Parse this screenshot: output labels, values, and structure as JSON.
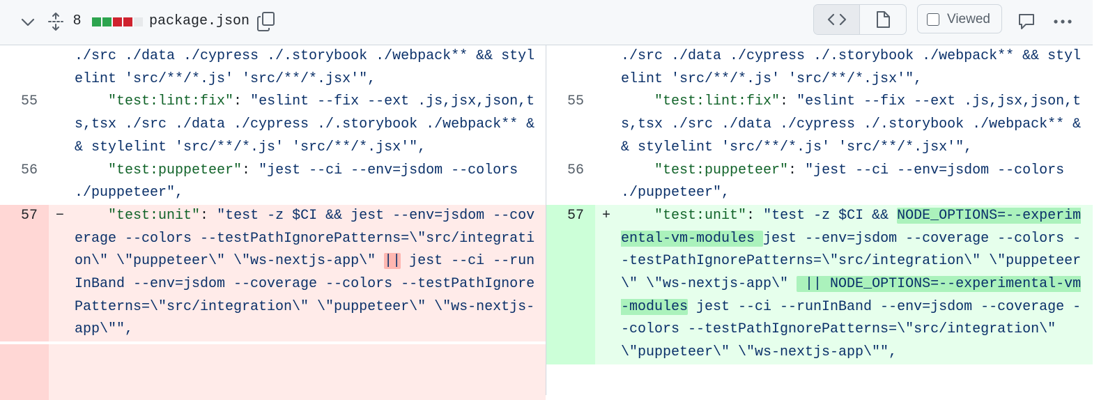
{
  "header": {
    "changes_count": "8",
    "diffstat_colors": [
      "#2da44e",
      "#2da44e",
      "#cf222e",
      "#cf222e",
      "#e7e9eb"
    ],
    "file_name": "package.json",
    "icons": {
      "collapse": "chevron-down-icon",
      "expand": "fold-expand-icon",
      "copy": "copy-icon",
      "code_view": "code-icon",
      "file_view": "file-icon",
      "comment": "comment-icon",
      "more": "kebab-horizontal-icon"
    },
    "viewed_label": "Viewed",
    "viewed_checked": false
  },
  "diff": {
    "colors": {
      "deletion_bg": "#ffebe9",
      "deletion_gutter": "#ffd7d5",
      "addition_bg": "#e6ffec",
      "addition_gutter": "#ccffd8"
    },
    "left": {
      "context_top": {
        "text": "./src ./data ./cypress ./.storybook ./webpack** && stylelint 'src/**/*.js' 'src/**/*.jsx'\","
      },
      "line55": {
        "number": "55",
        "indent": "    ",
        "key": "\"test:lint:fix\"",
        "sep": ": ",
        "value": "\"eslint --fix --ext .js,jsx,json,ts,tsx ./src ./data ./cypress ./.storybook ./webpack** && stylelint 'src/**/*.js' 'src/**/*.jsx'\","
      },
      "line56": {
        "number": "56",
        "indent": "    ",
        "key": "\"test:puppeteer\"",
        "sep": ": ",
        "value": "\"jest --ci --env=jsdom --colors ./puppeteer\","
      },
      "line57": {
        "number": "57",
        "marker": "−",
        "indent": "    ",
        "key": "\"test:unit\"",
        "sep": ": ",
        "part1": "\"test -z $CI && jest --env=jsdom --coverage --colors --testPathIgnorePatterns=\\\"src/integration\\\" \\\"puppeteer\\\" \\\"ws-nextjs-app\\\" ",
        "highlight": "||",
        "part2": " jest --ci --runInBand --env=jsdom --coverage --colors --testPathIgnorePatterns=\\\"src/integration\\\" \\\"puppeteer\\\" \\\"ws-nextjs-app\\\"\","
      }
    },
    "right": {
      "context_top": {
        "text": "./src ./data ./cypress ./.storybook ./webpack** && stylelint 'src/**/*.js' 'src/**/*.jsx'\","
      },
      "line55": {
        "number": "55",
        "indent": "    ",
        "key": "\"test:lint:fix\"",
        "sep": ": ",
        "value": "\"eslint --fix --ext .js,jsx,json,ts,tsx ./src ./data ./cypress ./.storybook ./webpack** && stylelint 'src/**/*.js' 'src/**/*.jsx'\","
      },
      "line56": {
        "number": "56",
        "indent": "    ",
        "key": "\"test:puppeteer\"",
        "sep": ": ",
        "value": "\"jest --ci --env=jsdom --colors ./puppeteer\","
      },
      "line57": {
        "number": "57",
        "marker": "+",
        "indent": "    ",
        "key": "\"test:unit\"",
        "sep": ": ",
        "part1": "\"test -z $CI && ",
        "highlight1": "NODE_OPTIONS=--experimental-vm-modules ",
        "part2": "jest --env=jsdom --coverage --colors --testPathIgnorePatterns=\\\"src/integration\\\" \\\"puppeteer\\\" \\\"ws-nextjs-app\\\" ",
        "highlight2": " || NODE_OPTIONS=--experimental-vm-modules",
        "part3": " jest --ci --runInBand --env=jsdom --coverage --colors --testPathIgnorePatterns=\\\"src/integration\\\" \\\"puppeteer\\\" \\\"ws-nextjs-app\\\"\","
      }
    }
  }
}
